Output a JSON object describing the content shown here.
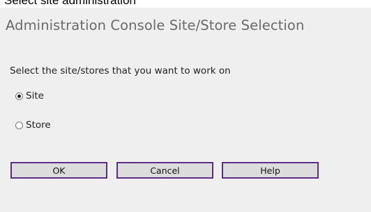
{
  "caption": "Select site administration",
  "title": "Administration Console Site/Store Selection",
  "prompt": "Select the site/stores that you want to work on",
  "options": [
    {
      "label": "Site",
      "selected": true
    },
    {
      "label": "Store",
      "selected": false
    }
  ],
  "buttons": {
    "ok": "OK",
    "cancel": "Cancel",
    "help": "Help"
  },
  "colors": {
    "panel_background": "#efefef",
    "title_text": "#6a6a6a",
    "button_border": "#5a2e86",
    "button_face": "#dcdcdc"
  }
}
